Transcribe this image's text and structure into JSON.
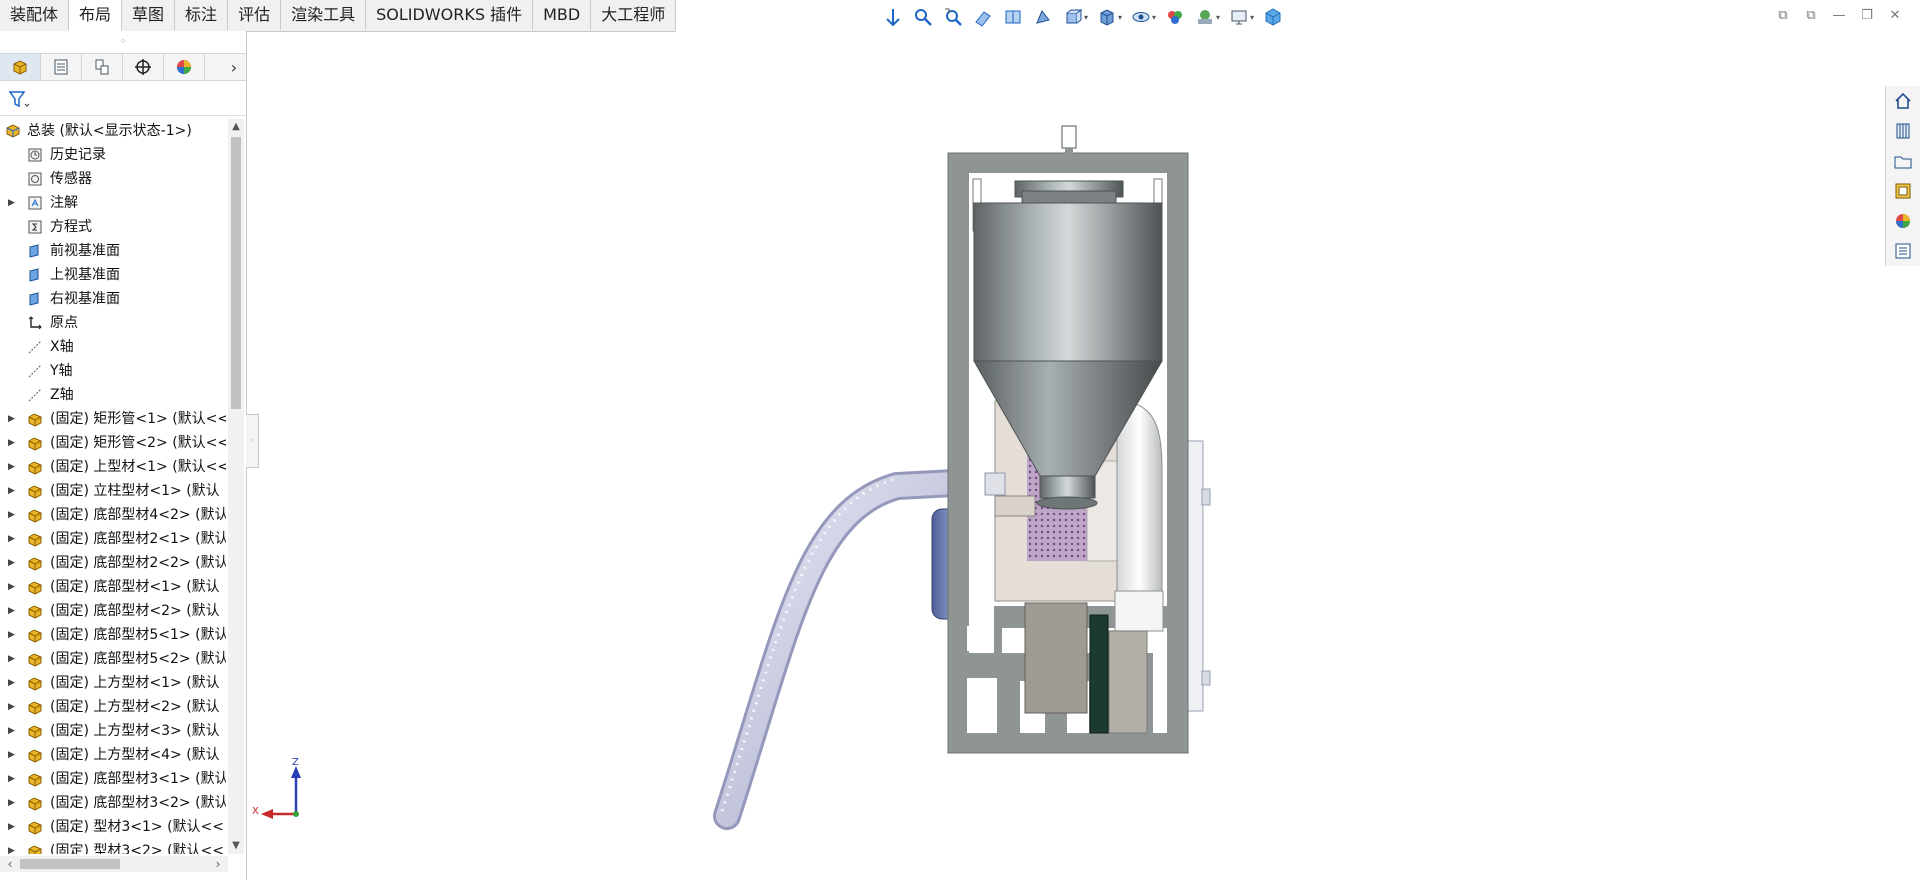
{
  "tabs": [
    {
      "label": "装配体",
      "active": false
    },
    {
      "label": "布局",
      "active": true
    },
    {
      "label": "草图",
      "active": false
    },
    {
      "label": "标注",
      "active": false
    },
    {
      "label": "评估",
      "active": false
    },
    {
      "label": "渲染工具",
      "active": false
    },
    {
      "label": "SOLIDWORKS 插件",
      "active": false
    },
    {
      "label": "MBD",
      "active": false
    },
    {
      "label": "大工程师",
      "active": false
    }
  ],
  "tree": {
    "root": "总装  (默认<显示状态-1>)",
    "items": [
      {
        "label": "历史记录",
        "icon": "history-icon",
        "expandable": false
      },
      {
        "label": "传感器",
        "icon": "sensor-icon",
        "expandable": false
      },
      {
        "label": "注解",
        "icon": "annotation-icon",
        "expandable": true
      },
      {
        "label": "方程式",
        "icon": "equation-icon",
        "expandable": false
      },
      {
        "label": "前视基准面",
        "icon": "plane-icon",
        "expandable": false
      },
      {
        "label": "上视基准面",
        "icon": "plane-icon",
        "expandable": false
      },
      {
        "label": "右视基准面",
        "icon": "plane-icon",
        "expandable": false
      },
      {
        "label": "原点",
        "icon": "origin-icon",
        "expandable": false
      },
      {
        "label": "X轴",
        "icon": "axis-icon",
        "expandable": false
      },
      {
        "label": "Y轴",
        "icon": "axis-icon",
        "expandable": false
      },
      {
        "label": "Z轴",
        "icon": "axis-icon",
        "expandable": false
      },
      {
        "label": "(固定) 矩形管<1> (默认<<",
        "icon": "part-icon",
        "expandable": true
      },
      {
        "label": "(固定) 矩形管<2> (默认<<",
        "icon": "part-icon",
        "expandable": true
      },
      {
        "label": "(固定) 上型材<1> (默认<<",
        "icon": "part-icon",
        "expandable": true
      },
      {
        "label": "(固定) 立柱型材<1> (默认",
        "icon": "part-icon",
        "expandable": true
      },
      {
        "label": "(固定) 底部型材4<2> (默认",
        "icon": "part-icon",
        "expandable": true
      },
      {
        "label": "(固定) 底部型材2<1> (默认",
        "icon": "part-icon",
        "expandable": true
      },
      {
        "label": "(固定) 底部型材2<2> (默认",
        "icon": "part-icon",
        "expandable": true
      },
      {
        "label": "(固定) 底部型材<1> (默认",
        "icon": "part-icon",
        "expandable": true
      },
      {
        "label": "(固定) 底部型材<2> (默认",
        "icon": "part-icon",
        "expandable": true
      },
      {
        "label": "(固定) 底部型材5<1> (默认",
        "icon": "part-icon",
        "expandable": true
      },
      {
        "label": "(固定) 底部型材5<2> (默认",
        "icon": "part-icon",
        "expandable": true
      },
      {
        "label": "(固定) 上方型材<1> (默认",
        "icon": "part-icon",
        "expandable": true
      },
      {
        "label": "(固定) 上方型材<2> (默认",
        "icon": "part-icon",
        "expandable": true
      },
      {
        "label": "(固定) 上方型材<3> (默认",
        "icon": "part-icon",
        "expandable": true
      },
      {
        "label": "(固定) 上方型材<4> (默认",
        "icon": "part-icon",
        "expandable": true
      },
      {
        "label": "(固定) 底部型材3<1> (默认",
        "icon": "part-icon",
        "expandable": true
      },
      {
        "label": "(固定) 底部型材3<2> (默认",
        "icon": "part-icon",
        "expandable": true
      },
      {
        "label": "(固定) 型材3<1> (默认<<",
        "icon": "part-icon",
        "expandable": true
      },
      {
        "label": "(固定) 型材3<2> (默认<<",
        "icon": "part-icon",
        "expandable": true
      }
    ]
  },
  "triad": {
    "z": "Z",
    "x": "X"
  },
  "colors": {
    "accent": "#1e66c8",
    "part": "#e8b62a",
    "frame": "#8f9595"
  }
}
